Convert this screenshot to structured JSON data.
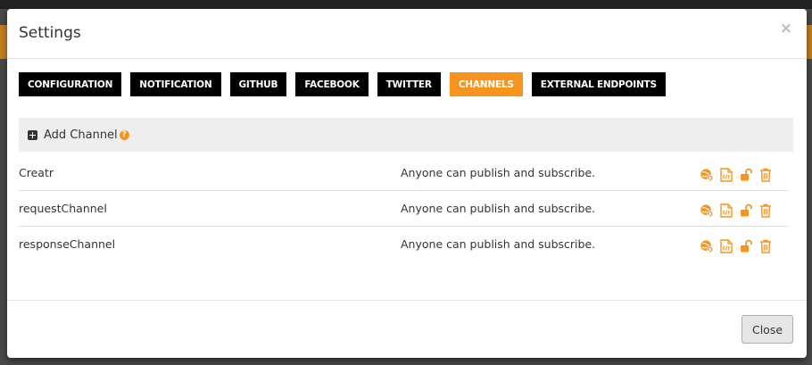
{
  "modal": {
    "title": "Settings",
    "close_symbol": "×",
    "footer_close_label": "Close"
  },
  "tabs": [
    {
      "label": "CONFIGURATION",
      "active": false
    },
    {
      "label": "NOTIFICATION",
      "active": false
    },
    {
      "label": "GITHUB",
      "active": false
    },
    {
      "label": "FACEBOOK",
      "active": false
    },
    {
      "label": "TWITTER",
      "active": false
    },
    {
      "label": "CHANNELS",
      "active": true
    },
    {
      "label": "EXTERNAL ENDPOINTS",
      "active": false
    }
  ],
  "add_channel": {
    "label": "Add Channel",
    "help_symbol": "?"
  },
  "channels": [
    {
      "name": "Creatr",
      "permission": "Anyone can publish and subscribe."
    },
    {
      "name": "requestChannel",
      "permission": "Anyone can publish and subscribe."
    },
    {
      "name": "responseChannel",
      "permission": "Anyone can publish and subscribe."
    }
  ],
  "icons": {
    "row_actions": [
      "globe-refresh-icon",
      "code-file-icon",
      "unlock-icon",
      "trash-icon"
    ],
    "add": "plus-square-icon",
    "help": "question-circle-icon"
  },
  "colors": {
    "accent": "#f7941d",
    "tab_bg": "#000000",
    "add_bar_bg": "#eeeeee"
  }
}
